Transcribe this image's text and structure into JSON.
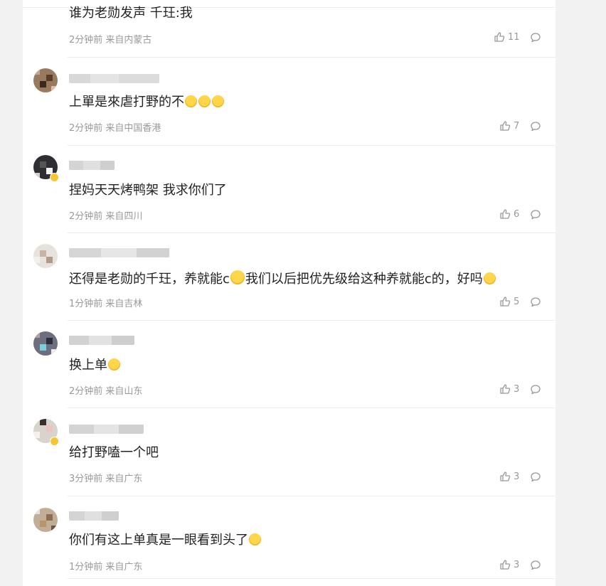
{
  "comments": [
    {
      "text": "谁为老勋发声 千玨:我",
      "meta": "2分钟前 来自内蒙古",
      "likes": "11"
    },
    {
      "text_parts": [
        "上單是來虐打野的不"
      ],
      "emoji_count": 3,
      "meta": "2分钟前 来自中国香港",
      "likes": "7"
    },
    {
      "text": "捏妈天天烤鸭架 我求你们了",
      "meta": "2分钟前 来自四川",
      "likes": "6"
    },
    {
      "text_parts": [
        "还得是老勋的千玨，养就能c",
        "我们以后把优先级给这种养就能c的，好吗"
      ],
      "meta": "1分钟前 来自吉林",
      "likes": "5"
    },
    {
      "text": "换上单",
      "meta": "2分钟前 来自山东",
      "likes": "3"
    },
    {
      "text": "给打野嗑一个吧",
      "meta": "3分钟前 来自广东",
      "likes": "3"
    },
    {
      "text": "你们有这上单真是一眼看到头了",
      "meta": "1分钟前 来自广东",
      "likes": "3"
    }
  ],
  "icons": {
    "like": "thumbs-up-icon",
    "reply": "speech-bubble-icon"
  },
  "colors": {
    "text": "#222222",
    "meta": "#999999",
    "separator": "#ebebeb",
    "background": "#f2f2f2"
  }
}
